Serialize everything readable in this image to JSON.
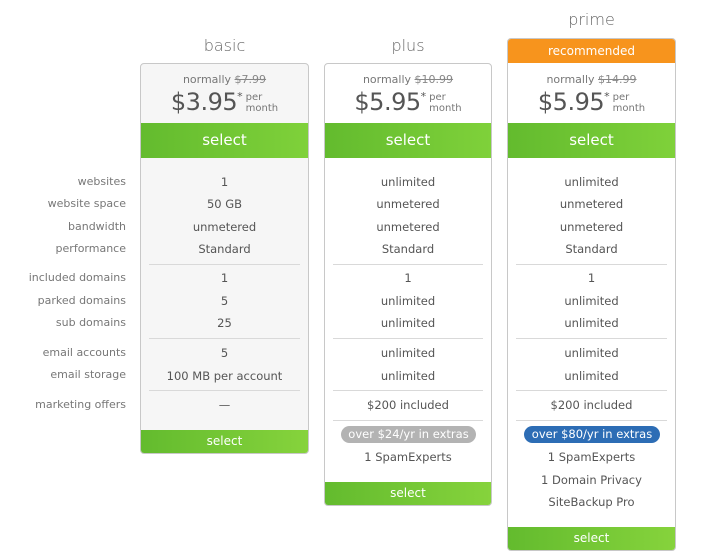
{
  "feature_labels": [
    "websites",
    "website space",
    "bandwidth",
    "performance",
    "included domains",
    "parked domains",
    "sub domains",
    "email accounts",
    "email storage",
    "marketing offers"
  ],
  "plans": [
    {
      "name": "basic",
      "normally_label": "normally",
      "normal_price": "$7.99",
      "price": "$3.95",
      "asterisk": "*",
      "per_line1": "per",
      "per_line2": "month",
      "select_label": "select",
      "features": [
        "1",
        "50 GB",
        "unmetered",
        "Standard",
        "1",
        "5",
        "25",
        "5",
        "100 MB per account",
        "—"
      ],
      "bottom_select_label": "select"
    },
    {
      "name": "plus",
      "normally_label": "normally",
      "normal_price": "$10.99",
      "price": "$5.95",
      "asterisk": "*",
      "per_line1": "per",
      "per_line2": "month",
      "select_label": "select",
      "features": [
        "unlimited",
        "unmetered",
        "unmetered",
        "Standard",
        "1",
        "unlimited",
        "unlimited",
        "unlimited",
        "unlimited",
        "$200 included"
      ],
      "extras_badge": "over $24/yr in extras",
      "extras": [
        "1 SpamExperts"
      ],
      "bottom_select_label": "select"
    },
    {
      "name": "prime",
      "ribbon": "recommended",
      "normally_label": "normally",
      "normal_price": "$14.99",
      "price": "$5.95",
      "asterisk": "*",
      "per_line1": "per",
      "per_line2": "month",
      "select_label": "select",
      "features": [
        "unlimited",
        "unmetered",
        "unmetered",
        "Standard",
        "1",
        "unlimited",
        "unlimited",
        "unlimited",
        "unlimited",
        "$200 included"
      ],
      "extras_badge": "over $80/yr in extras",
      "extras": [
        "1 SpamExperts",
        "1 Domain Privacy",
        "SiteBackup Pro"
      ],
      "bottom_select_label": "select"
    }
  ],
  "colors": {
    "select_green": "#6cc532",
    "recommended_orange": "#f7941d",
    "extras_gray": "#b3b3b3",
    "extras_blue": "#2d6db5"
  }
}
